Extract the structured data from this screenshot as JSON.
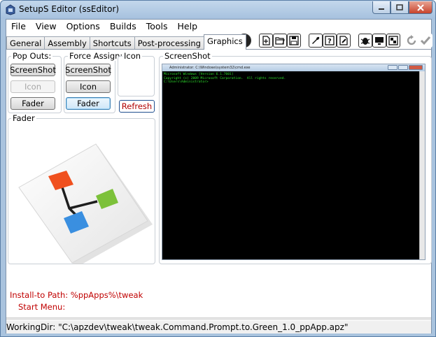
{
  "window": {
    "title": "SetupS Editor (ssEditor)"
  },
  "menu": [
    "File",
    "View",
    "Options",
    "Builds",
    "Tools",
    "Help"
  ],
  "tabs": [
    "General",
    "Assembly",
    "Shortcuts",
    "Post-processing",
    "Graphics"
  ],
  "active_tab": "Graphics",
  "toolbar_icons": [
    "help-icon",
    "new-file-icon",
    "open-folder-icon",
    "save-icon",
    "wrench-icon",
    "help-doc-icon",
    "edit-doc-icon",
    "bug-icon",
    "monitor-icon",
    "window-icon",
    "undo-icon",
    "check-icon"
  ],
  "pop_outs": {
    "label": "Pop Outs:",
    "screenshot": "ScreenShot",
    "icon": "Icon",
    "fader": "Fader"
  },
  "force_assign": {
    "label": "Force Assign:",
    "screenshot": "ScreenShot",
    "icon": "Icon",
    "fader": "Fader"
  },
  "icon_group": {
    "label": "Icon",
    "refresh": "Refresh"
  },
  "fader_group": {
    "label": "Fader"
  },
  "screenshot_group": {
    "label": "ScreenShot",
    "cmd_title": "Administrator: C:\\Windows\\system32\\cmd.exe",
    "cmd_lines": [
      "Microsoft Windows [Version 6.1.7601]",
      "Copyright (c) 2009 Microsoft Corporation.  All rights reserved.",
      "",
      "C:\\Users\\Administrator>"
    ]
  },
  "paths": {
    "install_label": "Install-to Path:",
    "install_value": "%ppApps%\\tweak",
    "start_menu_label": "Start Menu:",
    "start_menu_value": ""
  },
  "status": {
    "working_dir": "WorkingDir: \"C:\\apzdev\\tweak\\tweak.Command.Prompt.to.Green_1.0_ppApp.apz\""
  },
  "colors": {
    "accent_red": "#c00000",
    "cmd_text": "#2de32d",
    "fader_orange": "#f0501e",
    "fader_green": "#7cc13a",
    "fader_blue": "#3a8fe0"
  }
}
